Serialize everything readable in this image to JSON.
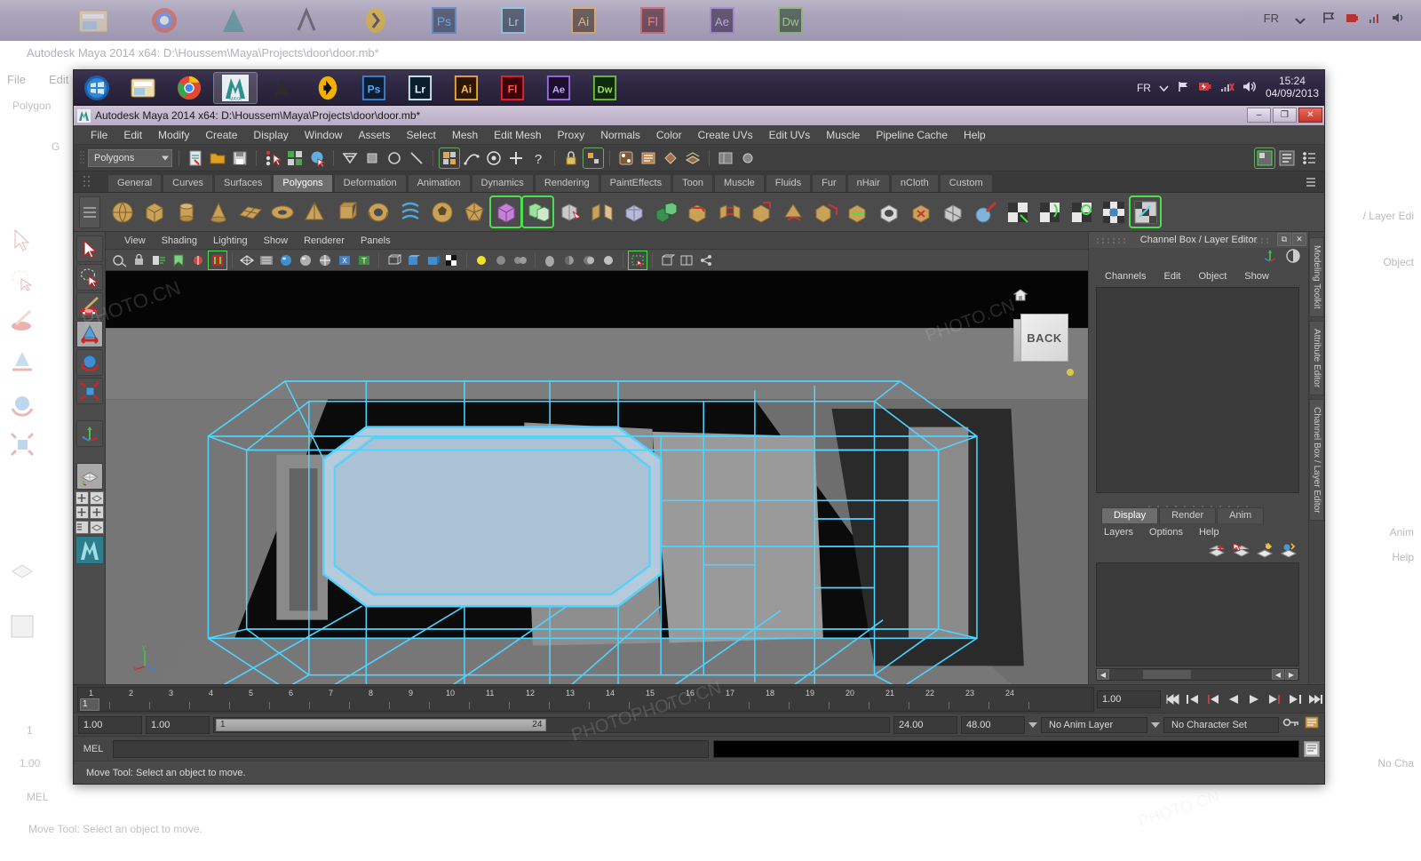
{
  "desktop": {
    "background_title": "Autodesk Maya 2014 x64: D:\\Houssem\\Maya\\Projects\\door\\door.mb*",
    "ghost_menus": [
      "File",
      "Edit"
    ],
    "ghost_polygons": "Polygon",
    "ghost_right": [
      "/ Layer Edi",
      "Object",
      "Channel Box / Layer Editor",
      "Anim",
      "Help",
      "No Cha"
    ],
    "ghost_left": [
      "1",
      "1.00",
      "MEL"
    ],
    "ghost_status": "Move Tool: Select an object to move.",
    "watermarks": [
      "PHOTO.CN",
      "PHOTOPHOTO.CN"
    ]
  },
  "taskbar": {
    "items": [
      {
        "name": "start-orb",
        "label": ""
      },
      {
        "name": "file-explorer",
        "label": ""
      },
      {
        "name": "chrome",
        "label": ""
      },
      {
        "name": "maya",
        "label": "MAYA"
      },
      {
        "name": "zbrush",
        "label": ""
      },
      {
        "name": "nuke",
        "label": ""
      },
      {
        "name": "photoshop",
        "label": "Ps"
      },
      {
        "name": "lightroom",
        "label": "Lr"
      },
      {
        "name": "illustrator",
        "label": "Ai"
      },
      {
        "name": "flash",
        "label": "Fl"
      },
      {
        "name": "after-effects",
        "label": "Ae"
      },
      {
        "name": "dreamweaver",
        "label": "Dw"
      }
    ],
    "tray": {
      "language": "FR",
      "time": "15:24",
      "date": "04/09/2013"
    }
  },
  "window": {
    "title": "Autodesk Maya 2014 x64: D:\\Houssem\\Maya\\Projects\\door\\door.mb*",
    "buttons": {
      "minimize": "–",
      "maximize": "❐",
      "close": "✕"
    }
  },
  "menubar": {
    "items": [
      "File",
      "Edit",
      "Modify",
      "Create",
      "Display",
      "Window",
      "Assets",
      "Select",
      "Mesh",
      "Edit Mesh",
      "Proxy",
      "Normals",
      "Color",
      "Create UVs",
      "Edit UVs",
      "Muscle",
      "Pipeline Cache",
      "Help"
    ]
  },
  "statusline": {
    "menuset": "Polygons",
    "icons": [
      "selection-mask-icon",
      "open-scene-icon",
      "save-scene-icon",
      "undo-icon",
      "select-by-hierarchy-icon",
      "select-by-object-icon",
      "select-by-component-icon",
      "snap-to-grid-icon",
      "snap-to-curve-icon",
      "snap-to-point-icon",
      "snap-to-projected-icon",
      "construction-history-icon",
      "render-view-icon",
      "render-settings-icon",
      "hypershade-icon",
      "ipr-render-icon",
      "render-globals-icon",
      "light-icon",
      "display-icon",
      "set-icon",
      "toggle-icon",
      "channel-box-icon",
      "attribute-editor-icon",
      "tool-settings-icon"
    ]
  },
  "shelf": {
    "tabs": [
      "General",
      "Curves",
      "Surfaces",
      "Polygons",
      "Deformation",
      "Animation",
      "Dynamics",
      "Rendering",
      "PaintEffects",
      "Toon",
      "Muscle",
      "Fluids",
      "Fur",
      "nHair",
      "nCloth",
      "Custom"
    ],
    "active_tab": "Polygons",
    "buttons": [
      "poly-sphere",
      "poly-cube",
      "poly-cylinder",
      "poly-cone",
      "poly-plane",
      "poly-torus",
      "poly-pyramid",
      "poly-prism",
      "poly-pipe",
      "poly-helix",
      "poly-soccer-ball",
      "poly-platonic",
      "poly-type",
      "poly-combine",
      "poly-boolean",
      "poly-mirror",
      "poly-smooth",
      "poly-extrude",
      "poly-bevel",
      "poly-bridge",
      "poly-append",
      "poly-wedge",
      "poly-duplicate-face",
      "poly-connect",
      "poly-fill-hole",
      "poly-reduce",
      "poly-triangulate",
      "poly-sculpt",
      "uv-planar",
      "uv-cylindrical",
      "uv-spherical",
      "uv-automatic",
      "uv-editor"
    ],
    "selected_index": 12
  },
  "toolbox": {
    "tools": [
      {
        "name": "select-tool",
        "active": false
      },
      {
        "name": "lasso-select-tool",
        "active": false
      },
      {
        "name": "paint-select-tool",
        "active": false
      },
      {
        "name": "move-tool",
        "active": true
      },
      {
        "name": "rotate-tool",
        "active": false
      },
      {
        "name": "scale-tool",
        "active": false
      },
      {
        "name": "last-tool-used",
        "active": false
      },
      {
        "name": "show-manipulator-tool",
        "active": false
      }
    ],
    "layouts": [
      "single-perspective-layout",
      "four-view-layout",
      "outliner-persp-layout",
      "persp-graph-layout",
      "hypershade-persp-layout",
      "persp-layout"
    ]
  },
  "viewport": {
    "menus": [
      "View",
      "Shading",
      "Lighting",
      "Show",
      "Renderer",
      "Panels"
    ],
    "toolbar_icons": [
      "select-camera-icon",
      "lock-camera-icon",
      "camera-attributes-icon",
      "bookmark-icon",
      "image-plane-icon",
      "two-d-pan-zoom-icon",
      "grease-pencil-icon",
      "wireframe-icon",
      "smooth-shade-icon",
      "shaded-textured-icon",
      "smooth-shade-all-icon",
      "wireframe-on-shaded-icon",
      "xray-icon",
      "xray-joints-icon",
      "lighting-default-icon",
      "lighting-all-icon",
      "shadows-icon",
      "occlusion-icon",
      "motion-blur-icon",
      "multisample-icon",
      "isolate-select-icon",
      "grid-icon",
      "film-gate-icon",
      "render-region-icon"
    ],
    "viewcube_label": "BACK",
    "axis_labels": [
      "y",
      "x",
      "z"
    ]
  },
  "channelbox": {
    "title": "Channel Box / Layer Editor",
    "menus": [
      "Channels",
      "Edit",
      "Object",
      "Show"
    ],
    "layer_tabs": [
      "Display",
      "Render",
      "Anim"
    ],
    "active_layer_tab": "Display",
    "layer_menus": [
      "Layers",
      "Options",
      "Help"
    ]
  },
  "right_tabs": [
    "Modeling Toolkit",
    "Attribute Editor",
    "Channel Box / Layer Editor"
  ],
  "timeline": {
    "frames": [
      "1",
      "2",
      "3",
      "4",
      "5",
      "6",
      "7",
      "8",
      "9",
      "10",
      "11",
      "12",
      "13",
      "14",
      "15",
      "16",
      "17",
      "18",
      "19",
      "20",
      "21",
      "22",
      "23",
      "24"
    ],
    "current_frame": "1",
    "current_time_field": "1.00",
    "playback_buttons": [
      "go-to-start",
      "step-back-keyframe",
      "step-back-frame",
      "play-backwards",
      "play-forwards",
      "step-forward-frame",
      "step-forward-keyframe",
      "go-to-end"
    ]
  },
  "range": {
    "start_field": "1.00",
    "start_field2": "1.00",
    "bar_start": "1",
    "bar_end": "24",
    "end_field": "24.00",
    "max_field": "48.00",
    "anim_layer": "No Anim Layer",
    "character_set": "No Character Set"
  },
  "mel": {
    "label": "MEL",
    "input_value": "",
    "output_value": ""
  },
  "helpline": {
    "message": "Move Tool: Select an object to move."
  },
  "colors": {
    "wireframe": "#4fd3ff",
    "accent_green": "#49e04c",
    "panel_bg": "#484848",
    "viewport_bg": "#000000"
  }
}
